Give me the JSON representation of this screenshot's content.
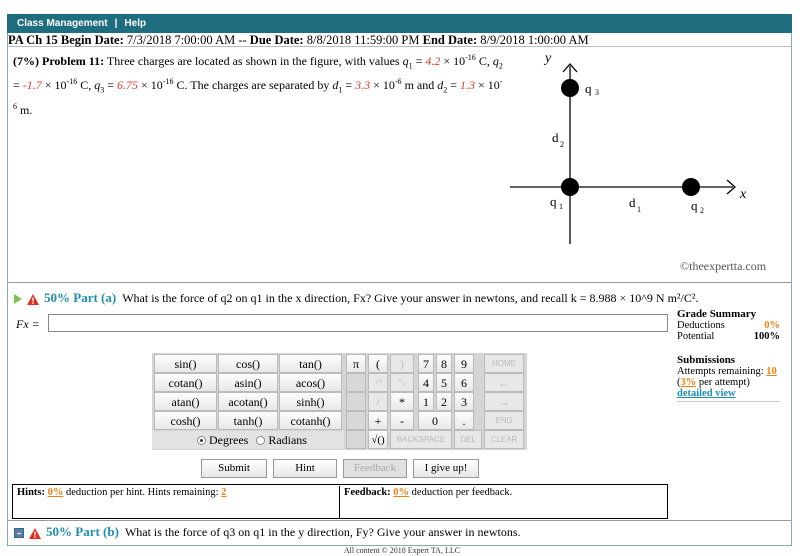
{
  "nav": {
    "class_management": "Class Management",
    "separator": "|",
    "help": "Help"
  },
  "dates": {
    "course": "PA Ch 15",
    "begin_label": "Begin Date:",
    "begin": "7/3/2018 7:00:00 AM",
    "dash": "--",
    "due_label": "Due Date:",
    "due": "8/8/2018 11:59:00 PM",
    "end_label": "End Date:",
    "end": "8/9/2018 1:00:00 AM"
  },
  "problem": {
    "weight": "(7%) Problem 11:",
    "intro": "Three charges are located as shown in the figure, with values",
    "q1_value": "4.2",
    "q2_value": "-1.7",
    "q3_value": "6.75",
    "text_sep": "The charges are separated by",
    "d1_value": "3.3",
    "d2_value": "1.3"
  },
  "figure": {
    "y_axis": "y",
    "x_axis": "x",
    "q1": "q",
    "q2": "q",
    "q3": "q",
    "d1": "d",
    "d2": "d",
    "copyright": "©theexpertta.com"
  },
  "part_a": {
    "percent": "50% Part (a)",
    "question": "What is the force of q2 on q1 in the x direction, Fx? Give your answer in newtons, and recall k = 8.988 × 10^9 N m²/C².",
    "answer_label": "Fx =",
    "answer_value": ""
  },
  "grade_summary": {
    "title": "Grade Summary",
    "deductions_label": "Deductions",
    "deductions": "0%",
    "potential_label": "Potential",
    "potential": "100%"
  },
  "submissions": {
    "title": "Submissions",
    "attempts_label": "Attempts remaining:",
    "attempts": "10",
    "per_attempt_pct": "3%",
    "per_attempt_text": "per attempt)",
    "detailed_view": "detailed view"
  },
  "keypad": {
    "functions": [
      "sin()",
      "cos()",
      "tan()",
      "cotan()",
      "asin()",
      "acos()",
      "atan()",
      "acotan()",
      "sinh()",
      "cosh()",
      "tanh()",
      "cotanh()"
    ],
    "pi": "π",
    "lparen": "(",
    "rparen": ")",
    "up": "↑^",
    "hat": "^↓",
    "divide": "/",
    "times": "*",
    "plus": "+",
    "minus": "-",
    "sqrt": "√()",
    "digits": [
      "7",
      "8",
      "9",
      "4",
      "5",
      "6",
      "1",
      "2",
      "3",
      "0",
      "."
    ],
    "home": "HOME",
    "left": "←",
    "right": "→",
    "end": "END",
    "backspace": "BACKSPACE",
    "del": "DEL",
    "clear": "CLEAR",
    "degrees": "Degrees",
    "radians": "Radians"
  },
  "buttons": {
    "submit": "Submit",
    "hint": "Hint",
    "feedback": "Feedback",
    "give_up": "I give up!"
  },
  "hints": {
    "label": "Hints:",
    "pct": "0%",
    "text": "deduction per hint. Hints remaining:",
    "remaining": "2"
  },
  "feedback": {
    "label": "Feedback:",
    "pct": "0%",
    "text": "deduction per feedback."
  },
  "part_b": {
    "percent": "50% Part (b)",
    "question": "What is the force of q3 on q1 in the y direction, Fy? Give your answer in newtons."
  },
  "footer": "All content © 2018 Expert TA, LLC"
}
